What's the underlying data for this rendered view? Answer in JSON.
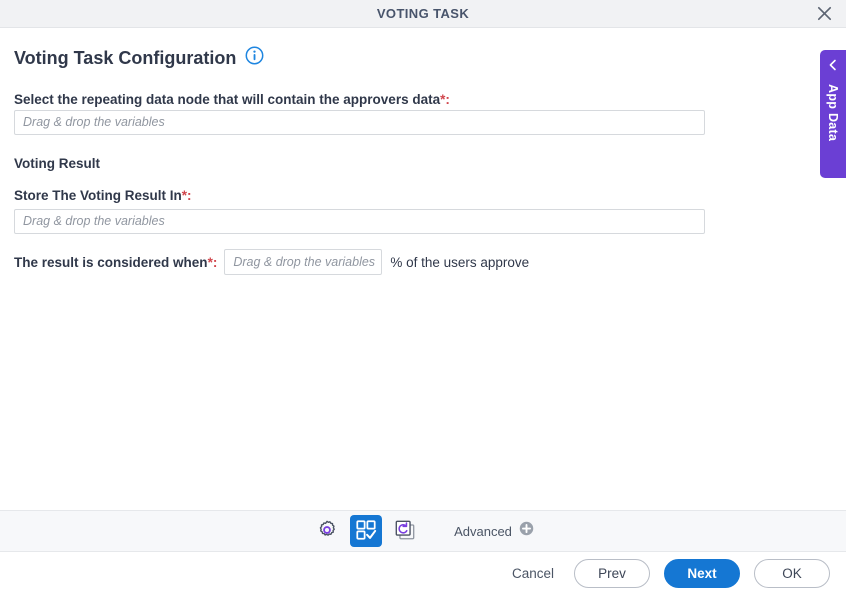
{
  "window": {
    "title": "VOTING TASK",
    "close_icon": "close-icon"
  },
  "heading": {
    "title": "Voting Task Configuration",
    "info_icon": "info-circle-icon"
  },
  "form": {
    "approvers_node": {
      "label": "Select the repeating data node that will contain the approvers data",
      "required_mark": "*:",
      "value": "",
      "placeholder": "Drag & drop the variables"
    },
    "voting_result_group": "Voting Result",
    "store_result": {
      "label": "Store The Voting Result In",
      "required_mark": "*:",
      "value": "",
      "placeholder": "Drag & drop the variables"
    },
    "threshold": {
      "label": "The result is considered when",
      "required_mark": "*:",
      "value": "",
      "placeholder": "Drag & drop the variables",
      "suffix": "% of the users approve"
    }
  },
  "app_data_tab": {
    "label": "App Data",
    "chevron_icon": "chevron-left-icon",
    "color": "#6b3fd4"
  },
  "toolbar": {
    "items": [
      {
        "name": "settings-gear-icon",
        "label": "Settings",
        "active": false
      },
      {
        "name": "task-grid-check-icon",
        "label": "Task Configuration",
        "active": true
      },
      {
        "name": "copy-refresh-icon",
        "label": "Reassign",
        "active": false
      }
    ],
    "advanced_label": "Advanced",
    "advanced_plus_icon": "plus-circle-icon",
    "active_color": "#1577d3",
    "accent_color": "#7a3fe0"
  },
  "footer": {
    "cancel": "Cancel",
    "prev": "Prev",
    "next": "Next",
    "ok": "OK",
    "primary_color": "#1577d3"
  }
}
